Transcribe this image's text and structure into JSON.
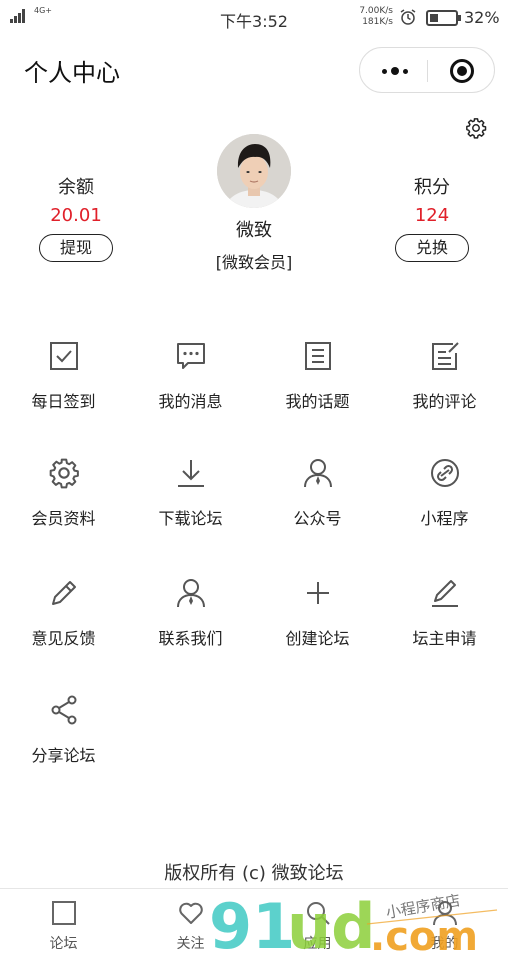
{
  "status_bar": {
    "network": "4G+",
    "time": "下午3:52",
    "speed_up": "7.00K/s",
    "speed_down": "181K/s",
    "battery_pct": "32%",
    "battery_level": 0.32
  },
  "navbar": {
    "title": "个人中心",
    "more_icon": "more-dots-icon",
    "close_icon": "target-circle-icon"
  },
  "profile": {
    "settings_icon": "gear-icon",
    "balance": {
      "label": "余额",
      "value": "20.01",
      "button": "提现"
    },
    "points": {
      "label": "积分",
      "value": "124",
      "button": "兑换"
    },
    "username": "微致",
    "level": "[微致会员]"
  },
  "menu": [
    {
      "label": "每日签到",
      "icon": "checkbox-icon"
    },
    {
      "label": "我的消息",
      "icon": "message-icon"
    },
    {
      "label": "我的话题",
      "icon": "document-lines-icon"
    },
    {
      "label": "我的评论",
      "icon": "edit-note-icon"
    },
    {
      "label": "会员资料",
      "icon": "gear-outline-icon"
    },
    {
      "label": "下载论坛",
      "icon": "download-icon"
    },
    {
      "label": "公众号",
      "icon": "person-tie-icon"
    },
    {
      "label": "小程序",
      "icon": "link-circle-icon"
    },
    {
      "label": "意见反馈",
      "icon": "pencil-icon"
    },
    {
      "label": "联系我们",
      "icon": "person-icon"
    },
    {
      "label": "创建论坛",
      "icon": "plus-icon"
    },
    {
      "label": "坛主申请",
      "icon": "pen-line-icon"
    },
    {
      "label": "分享论坛",
      "icon": "share-icon"
    }
  ],
  "footer": {
    "copyright": "版权所有 (c) 微致论坛"
  },
  "tabbar": [
    {
      "label": "论坛",
      "icon": "square-icon"
    },
    {
      "label": "关注",
      "icon": "heart-icon"
    },
    {
      "label": "应用",
      "icon": "search-icon"
    },
    {
      "label": "我的",
      "icon": "user-icon"
    }
  ],
  "watermark": {
    "brand": "91ud",
    "suffix": ".com",
    "tagline": "小程序商店"
  }
}
